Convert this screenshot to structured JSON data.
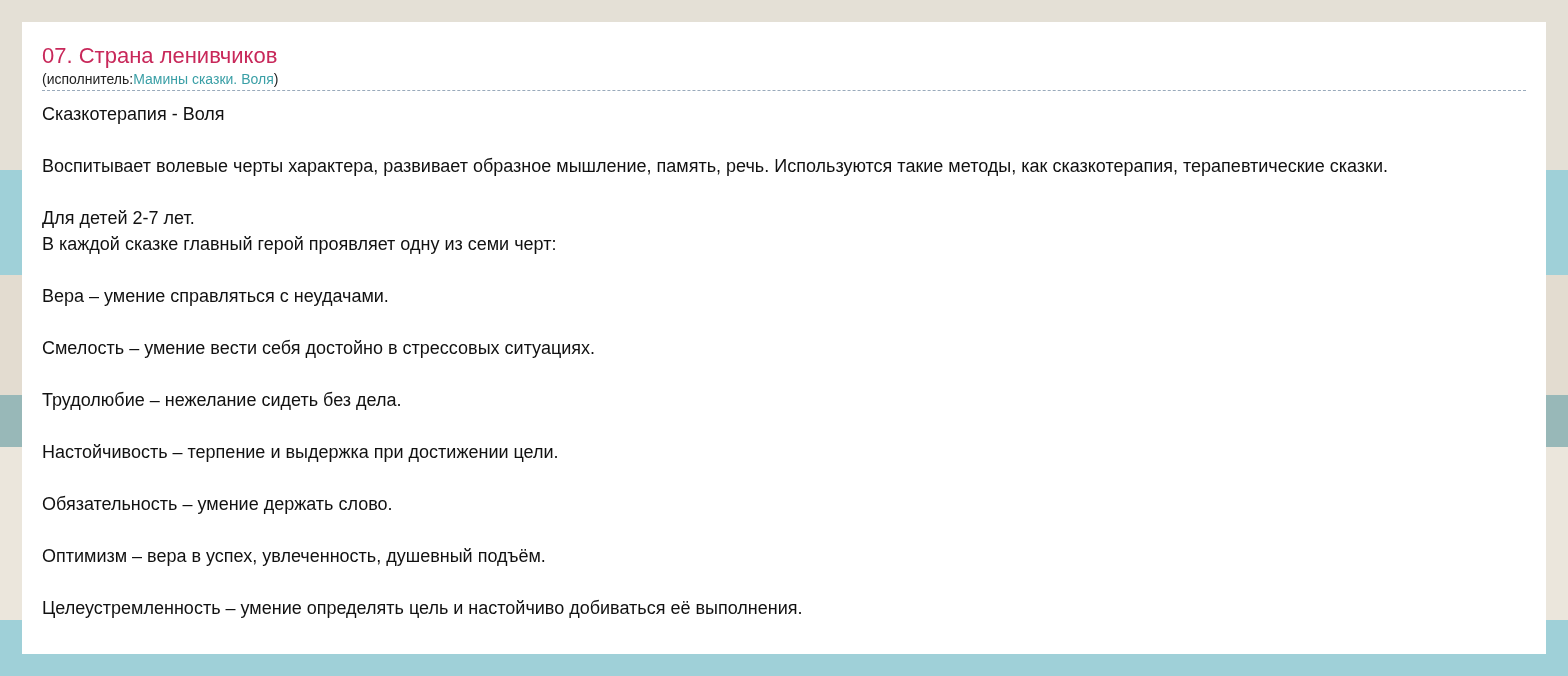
{
  "song": {
    "title": "07. Страна ленивчиков",
    "artist_label": "(исполнитель:",
    "artist": "Мамины сказки. Воля",
    "artist_close": ")"
  },
  "lyrics": [
    [
      "Сказкотерапия - Воля"
    ],
    [
      "Воспитывает волевые черты характера, развивает образное мышление, память, речь. Используются такие методы, как сказкотерапия, терапевтические сказки."
    ],
    [
      "Для детей 2-7 лет.",
      "В каждой сказке главный герой проявляет одну из семи черт:"
    ],
    [
      "Вера – умение справляться с неудачами."
    ],
    [
      "Смелость – умение вести себя достойно в стрессовых ситуациях."
    ],
    [
      "Трудолюбие – нежелание сидеть без дела."
    ],
    [
      "Настойчивость – терпение и выдержка при достижении цели."
    ],
    [
      "Обязательность – умение держать слово."
    ],
    [
      "Оптимизм – вера в успех, увлеченность, душевный подъём."
    ],
    [
      "Целеустремленность – умение определять цель и настойчиво добиваться её выполнения."
    ]
  ]
}
